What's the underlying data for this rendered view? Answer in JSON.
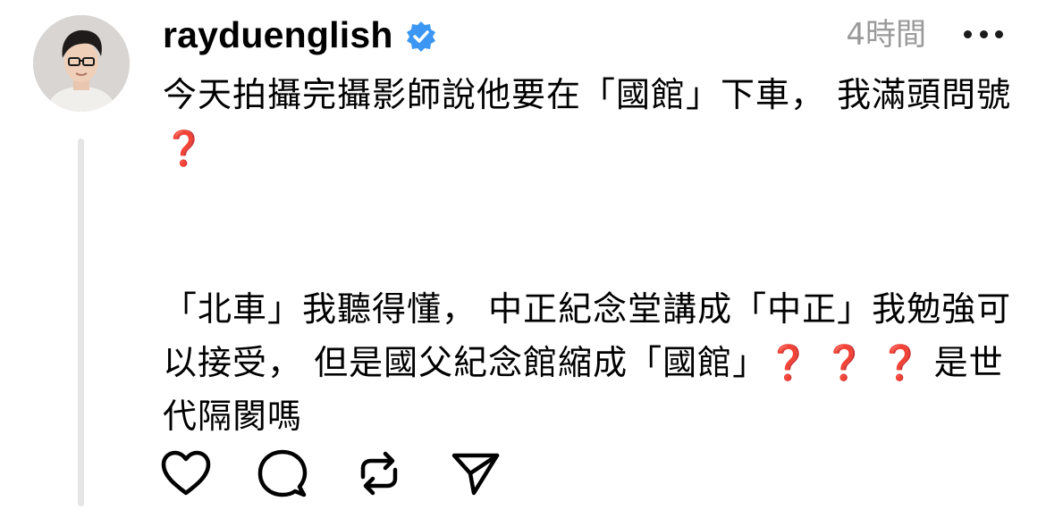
{
  "post": {
    "username": "rayduenglish",
    "verified": true,
    "time": "4時間",
    "more_icon": "more-icon",
    "body_line1": "今天拍攝完攝影師說他要在「國館」下車， 我滿頭問號",
    "body_line1_mark": "❓",
    "body_line2": "「北車」我聽得懂， 中正紀念堂講成「中正」我勉強可以接受， 但是國父紀念館縮成「國館」",
    "body_line2_marks": "❓ ❓ ❓",
    "body_line2_end": " 是世代隔閡嗎"
  },
  "actions": {
    "like": "heart-icon",
    "comment": "comment-icon",
    "repost": "repost-icon",
    "share": "send-icon"
  },
  "colors": {
    "verified": "#3b97f3",
    "question_mark": "#d9262c",
    "timestamp": "#9a9a9a",
    "thread_line": "#e5e5e5"
  }
}
